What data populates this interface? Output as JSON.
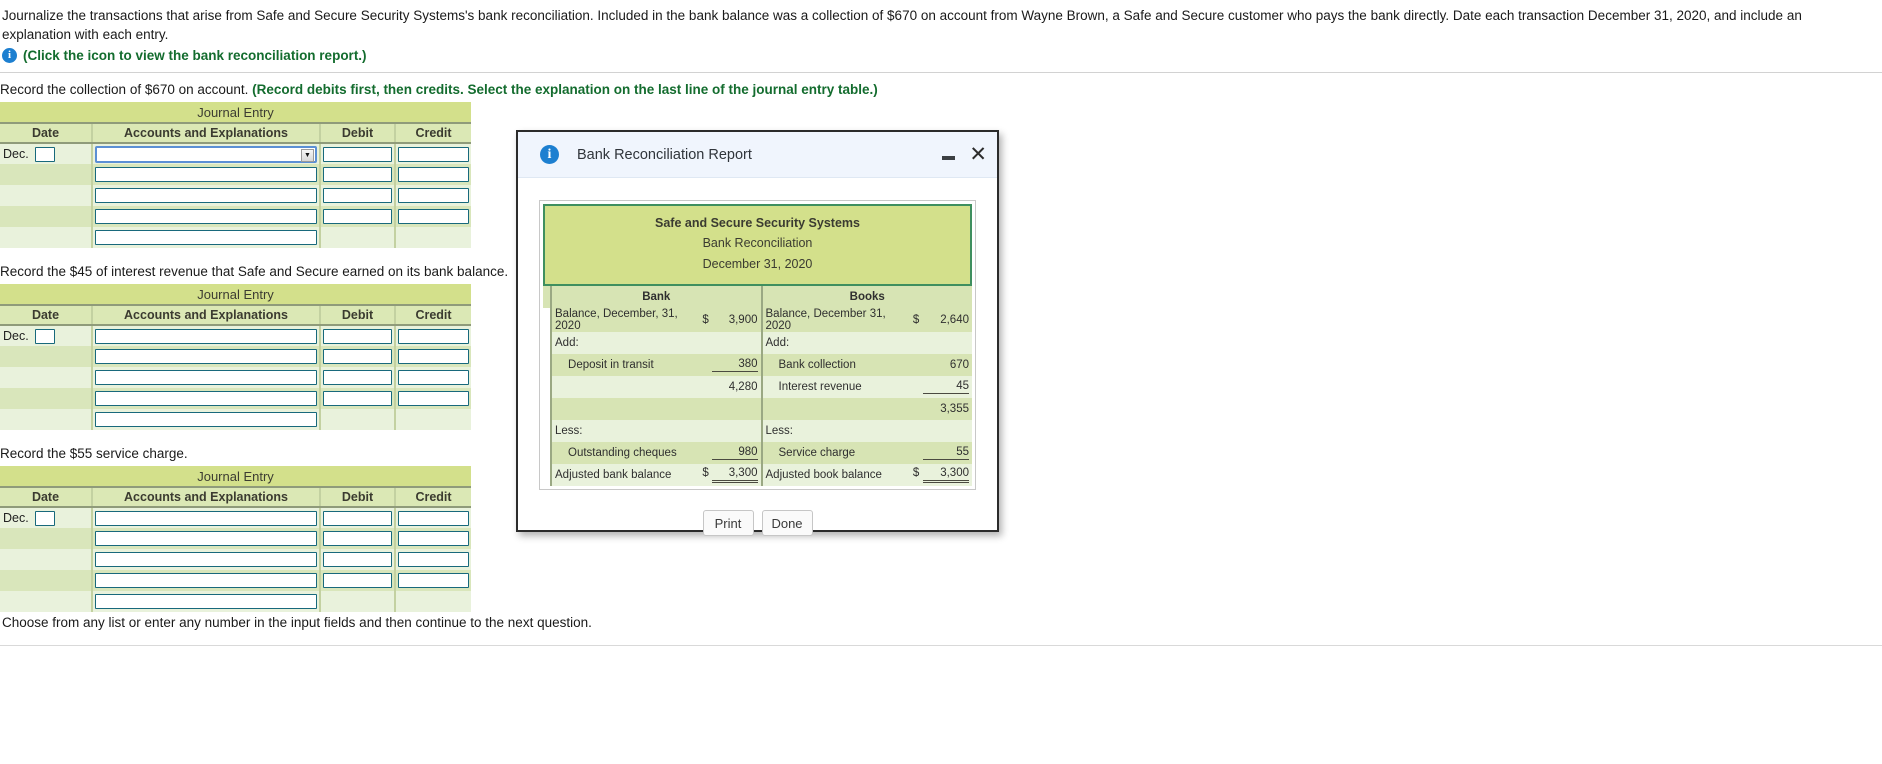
{
  "prompt": {
    "text": "Journalize the transactions that arise from Safe and Secure Security Systems's bank reconciliation. Included in the bank balance was a collection of $670 on account from Wayne Brown, a Safe and Secure customer who pays the bank directly. Date each transaction December 31, 2020, and include an explanation with each entry.",
    "icon_hint": "(Click the icon to view the bank reconciliation report.)",
    "info_glyph": "i"
  },
  "sections": [
    {
      "label_plain": "Record the collection of $670 on account. ",
      "label_em": "(Record debits first, then credits. Select the explanation on the last line of the journal entry table.)",
      "table": {
        "title": "Journal Entry",
        "headers": [
          "Date",
          "Accounts and Explanations",
          "Debit",
          "Credit"
        ],
        "month": "Dec.",
        "rows": 5
      }
    },
    {
      "label_plain": "Record the $45 of interest revenue that Safe and Secure earned on its bank balance.",
      "label_em": "",
      "table": {
        "title": "Journal Entry",
        "headers": [
          "Date",
          "Accounts and Explanations",
          "Debit",
          "Credit"
        ],
        "month": "Dec.",
        "rows": 5
      }
    },
    {
      "label_plain": "Record the $55 service charge.",
      "label_em": "",
      "table": {
        "title": "Journal Entry",
        "headers": [
          "Date",
          "Accounts and Explanations",
          "Debit",
          "Credit"
        ],
        "month": "Dec.",
        "rows": 5
      }
    }
  ],
  "bottom_note": "Choose from any list or enter any number in the input fields and then continue to the next question.",
  "modal": {
    "title": "Bank Reconciliation Report",
    "info_glyph": "i",
    "minimize_label": "",
    "close_glyph": "✕",
    "report": {
      "company": "Safe and Secure Security Systems",
      "statement": "Bank Reconciliation",
      "date": "December 31, 2020",
      "column_headers": [
        "Bank",
        "Books"
      ],
      "bank_rows": [
        {
          "label": "Balance, December, 31, 2020",
          "dollar": "$",
          "amount": "3,900",
          "rule": "none"
        },
        {
          "label": "Add:",
          "dollar": "",
          "amount": "",
          "rule": "none"
        },
        {
          "label": "Deposit in transit",
          "dollar": "",
          "amount": "380",
          "rule": "single",
          "indent": true
        },
        {
          "label": "",
          "dollar": "",
          "amount": "4,280",
          "rule": "none"
        },
        {
          "label": "",
          "dollar": "",
          "amount": "",
          "rule": "none"
        },
        {
          "label": "Less:",
          "dollar": "",
          "amount": "",
          "rule": "none"
        },
        {
          "label": "Outstanding cheques",
          "dollar": "",
          "amount": "980",
          "rule": "single",
          "indent": true
        },
        {
          "label": "Adjusted bank balance",
          "dollar": "$",
          "amount": "3,300",
          "rule": "double"
        }
      ],
      "books_rows": [
        {
          "label": "Balance, December 31, 2020",
          "dollar": "$",
          "amount": "2,640",
          "rule": "none"
        },
        {
          "label": "Add:",
          "dollar": "",
          "amount": "",
          "rule": "none"
        },
        {
          "label": "Bank collection",
          "dollar": "",
          "amount": "670",
          "rule": "none",
          "indent": true
        },
        {
          "label": "Interest revenue",
          "dollar": "",
          "amount": "45",
          "rule": "single",
          "indent": true
        },
        {
          "label": "",
          "dollar": "",
          "amount": "3,355",
          "rule": "none"
        },
        {
          "label": "Less:",
          "dollar": "",
          "amount": "",
          "rule": "none"
        },
        {
          "label": "Service charge",
          "dollar": "",
          "amount": "55",
          "rule": "single",
          "indent": true
        },
        {
          "label": "Adjusted book balance",
          "dollar": "$",
          "amount": "3,300",
          "rule": "double"
        }
      ]
    },
    "buttons": {
      "print": "Print",
      "done": "Done"
    }
  },
  "colors": {
    "accent_green": "#136c2e",
    "info_blue": "#1d7fd0",
    "table_title_bg": "#d3e08b",
    "table_head_bg": "#dbe8b5",
    "row_light": "#e9f2dc",
    "row_dark": "#d9e6bb",
    "report_border": "#3f8f5f",
    "input_border": "#18697c",
    "focus_border": "#5b8fd4"
  }
}
